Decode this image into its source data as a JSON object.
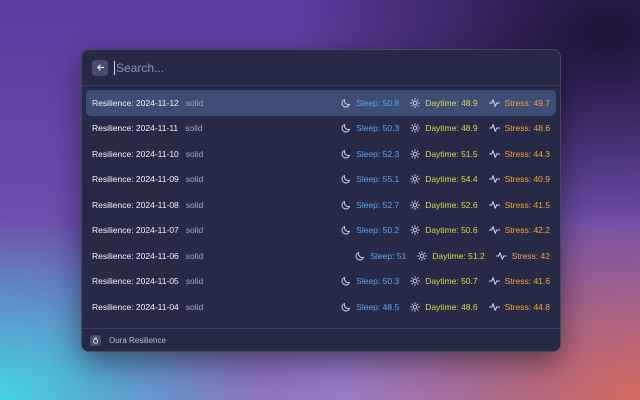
{
  "search": {
    "placeholder": "Search..."
  },
  "items": [
    {
      "title": "Resilience: 2024-11-12",
      "subtitle": "solid",
      "sleep": "Sleep: 50.8",
      "daytime": "Daytime: 48.9",
      "stress": "Stress: 49.7",
      "selected": true
    },
    {
      "title": "Resilience: 2024-11-11",
      "subtitle": "solid",
      "sleep": "Sleep: 50.3",
      "daytime": "Daytime: 48.9",
      "stress": "Stress: 48.6"
    },
    {
      "title": "Resilience: 2024-11-10",
      "subtitle": "solid",
      "sleep": "Sleep: 52.3",
      "daytime": "Daytime: 51.5",
      "stress": "Stress: 44.3"
    },
    {
      "title": "Resilience: 2024-11-09",
      "subtitle": "solid",
      "sleep": "Sleep: 55.1",
      "daytime": "Daytime: 54.4",
      "stress": "Stress: 40.9"
    },
    {
      "title": "Resilience: 2024-11-08",
      "subtitle": "solid",
      "sleep": "Sleep: 52.7",
      "daytime": "Daytime: 52.6",
      "stress": "Stress: 41.5"
    },
    {
      "title": "Resilience: 2024-11-07",
      "subtitle": "solid",
      "sleep": "Sleep: 50.2",
      "daytime": "Daytime: 50.6",
      "stress": "Stress: 42.2"
    },
    {
      "title": "Resilience: 2024-11-06",
      "subtitle": "solid",
      "sleep": "Sleep: 51",
      "daytime": "Daytime: 51.2",
      "stress": "Stress: 42"
    },
    {
      "title": "Resilience: 2024-11-05",
      "subtitle": "solid",
      "sleep": "Sleep: 50.3",
      "daytime": "Daytime: 50.7",
      "stress": "Stress: 41.6"
    },
    {
      "title": "Resilience: 2024-11-04",
      "subtitle": "solid",
      "sleep": "Sleep: 48.5",
      "daytime": "Daytime: 48.6",
      "stress": "Stress: 44.8"
    }
  ],
  "footer": {
    "app_name": "Oura Resilience"
  },
  "colors": {
    "sleep": "#5ba4f0",
    "daytime": "#cfd94f",
    "stress": "#f5a43a",
    "selected_row": "#3d4d76"
  },
  "icons": {
    "back": "arrow-left-icon",
    "sleep": "moon-icon",
    "daytime": "sun-icon",
    "stress": "pulse-icon",
    "app": "oura-ring-icon"
  }
}
